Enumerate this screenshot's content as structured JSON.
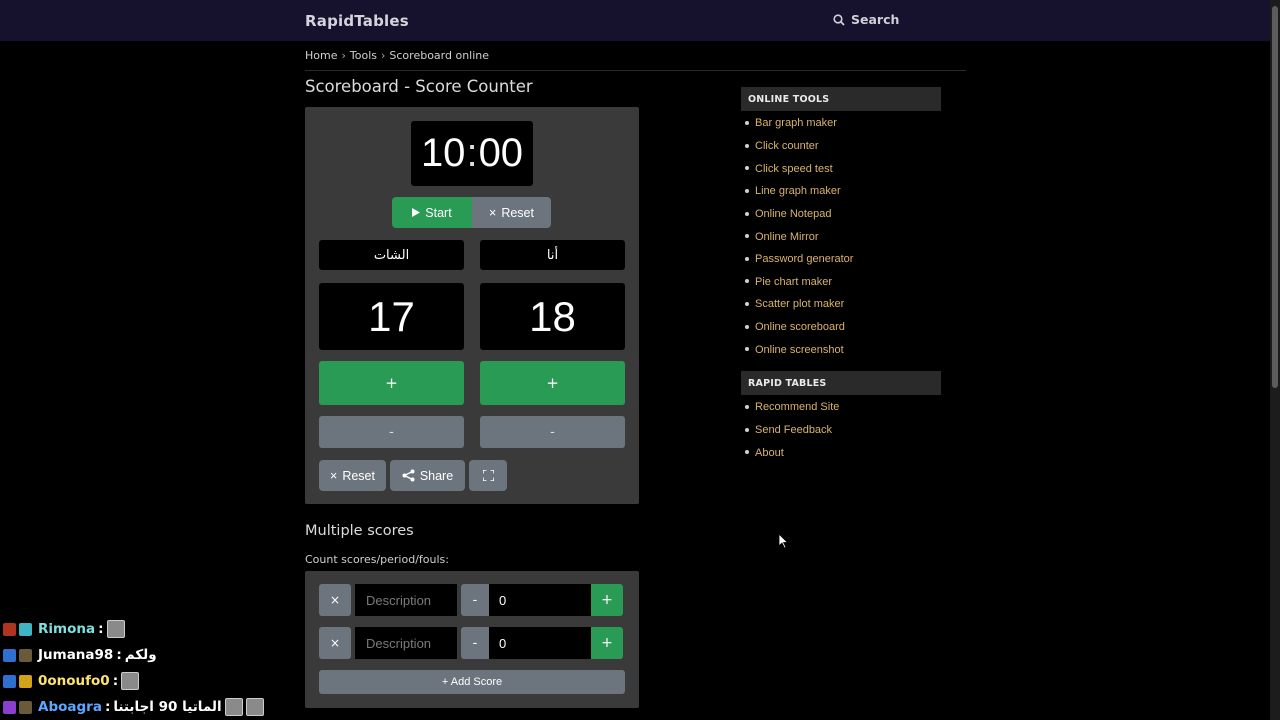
{
  "header": {
    "logo": "RapidTables",
    "search_label": "Search"
  },
  "breadcrumb": {
    "home": "Home",
    "tools": "Tools",
    "current": "Scoreboard online",
    "sep": "›"
  },
  "page_title": "Scoreboard - Score Counter",
  "scoreboard": {
    "timer_minutes": "10",
    "timer_colon": ":",
    "timer_seconds": "00",
    "start_label": "Start",
    "reset_label": "Reset",
    "team_a": {
      "name": "الشات",
      "score": "17",
      "plus": "+",
      "minus": "-"
    },
    "team_b": {
      "name": "أنا",
      "score": "18",
      "plus": "+",
      "minus": "-"
    },
    "bottom_reset": "Reset",
    "share": "Share"
  },
  "multiple": {
    "title": "Multiple scores",
    "subtitle": "Count scores/period/fouls:",
    "rows": [
      {
        "remove": "×",
        "placeholder": "Description",
        "minus": "-",
        "value": "0",
        "plus": "+"
      },
      {
        "remove": "×",
        "placeholder": "Description",
        "minus": "-",
        "value": "0",
        "plus": "+"
      }
    ],
    "add_label": "+ Add Score"
  },
  "sidebar": {
    "online_tools_title": "ONLINE TOOLS",
    "online_tools": [
      "Bar graph maker",
      "Click counter",
      "Click speed test",
      "Line graph maker",
      "Online Notepad",
      "Online Mirror",
      "Password generator",
      "Pie chart maker",
      "Scatter plot maker",
      "Online scoreboard",
      "Online screenshot"
    ],
    "rapid_tables_title": "RAPID TABLES",
    "rapid_tables": [
      "Recommend Site",
      "Send Feedback",
      "About"
    ]
  },
  "chat": [
    {
      "user": "Rimona",
      "sep": " :",
      "message": "",
      "color": "#7de2e0"
    },
    {
      "user": "Jumana98",
      "sep": " :",
      "message": "ولكم",
      "color": "#ffffff"
    },
    {
      "user": "0onoufo0",
      "sep": " :",
      "message": "",
      "color": "#ffe36e"
    },
    {
      "user": "Aboagra",
      "sep": " :",
      "message": "الماتيا 90 اجابتنا",
      "color": "#5aa9ff"
    }
  ],
  "colors": {
    "green": "#2a9b55",
    "gray_button": "#6c757d",
    "link": "#d9b36c",
    "topbar": "#16122d"
  }
}
